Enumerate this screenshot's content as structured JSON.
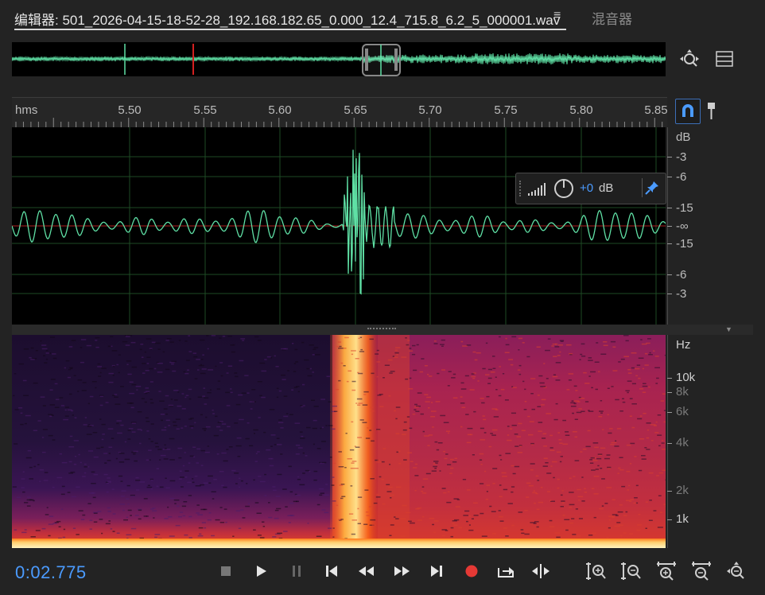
{
  "tabs": {
    "editor_label": "编辑器: 501_2026-04-15-18-52-28_192.168.182.65_0.000_12.4_715.8_6.2_5_000001.wav",
    "editor_menu_glyph": "≡",
    "mixer_label": "混音器"
  },
  "ruler": {
    "unit": "hms",
    "ticks": [
      "5.50",
      "5.55",
      "5.60",
      "5.65",
      "5.70",
      "5.75",
      "5.80",
      "5.85"
    ]
  },
  "amplitude_scale": {
    "unit": "dB",
    "labels": [
      "-3",
      "-6",
      "-15",
      "-∞",
      "-15",
      "-6",
      "-3"
    ]
  },
  "hud": {
    "gain_value": "+0",
    "gain_unit": "dB"
  },
  "frequency_scale": {
    "unit": "Hz",
    "labels": [
      "10k",
      "8k",
      "6k",
      "4k",
      "2k",
      "1k"
    ]
  },
  "transport": {
    "time": "0:02.775",
    "buttons": [
      "stop-icon",
      "play-icon",
      "pause-icon",
      "go-to-start-icon",
      "rewind-icon",
      "fast-forward-icon",
      "go-to-end-icon",
      "record-icon",
      "loop-icon",
      "skip-selection-icon"
    ]
  },
  "zoom_buttons": [
    "zoom-in-amplitude-icon",
    "zoom-out-amplitude-icon",
    "zoom-in-time-icon",
    "zoom-out-time-icon",
    "zoom-full-icon"
  ],
  "colors": {
    "waveform": "#5fe0a5",
    "accent_blue": "#4b9bff",
    "record_red": "#e53935",
    "playhead_red": "#d32020"
  }
}
